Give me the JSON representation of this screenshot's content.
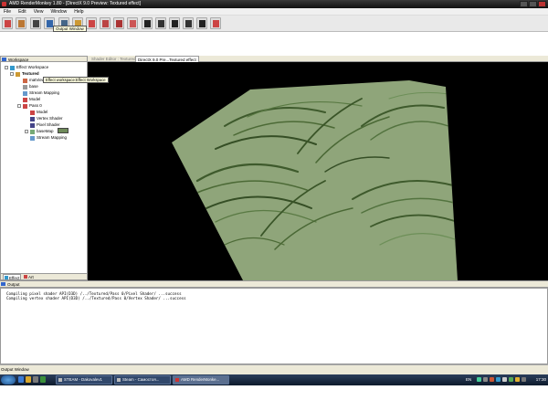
{
  "window": {
    "title": "AMD RenderMonkey 1.80 - [DirectX 9.0 Preview: Textured effect]"
  },
  "menu": [
    "File",
    "Edit",
    "View",
    "Window",
    "Help"
  ],
  "toolbar": {
    "tooltip": "Output Window",
    "buttons": [
      {
        "name": "toolbar-button-new",
        "color": "#c44"
      },
      {
        "name": "toolbar-button-open",
        "color": "#b73"
      },
      {
        "name": "toolbar-button-save",
        "color": "#444"
      },
      {
        "name": "toolbar-button-workspace",
        "color": "#36a"
      },
      {
        "name": "toolbar-button-preview",
        "color": "#468"
      },
      {
        "name": "toolbar-button-output",
        "color": "#c93"
      },
      {
        "name": "toolbar-button-add-1",
        "color": "#c44"
      },
      {
        "name": "toolbar-button-add-2",
        "color": "#b44"
      },
      {
        "name": "toolbar-button-add-3",
        "color": "#a33"
      },
      {
        "name": "toolbar-button-add-4",
        "color": "#c55"
      },
      {
        "name": "toolbar-button-camera-1",
        "color": "#222"
      },
      {
        "name": "toolbar-button-camera-2",
        "color": "#333"
      },
      {
        "name": "toolbar-button-camera-3",
        "color": "#222"
      },
      {
        "name": "toolbar-button-camera-4",
        "color": "#333"
      },
      {
        "name": "toolbar-button-camera-5",
        "color": "#222"
      },
      {
        "name": "toolbar-button-camera-6",
        "color": "#c44"
      }
    ]
  },
  "workspace": {
    "header": "Workspace",
    "tooltip": "Effect workspace:Effect Workspace",
    "nodes": [
      {
        "label": "Effect Workspace",
        "icon": "#39c",
        "bold": false
      },
      {
        "label": "Textured",
        "icon": "#c93",
        "bold": true
      },
      {
        "label": "matViewProj",
        "icon": "#c64",
        "bold": false
      },
      {
        "label": "base",
        "icon": "#999",
        "bold": false
      },
      {
        "label": "Stream Mapping",
        "icon": "#69c",
        "bold": false
      },
      {
        "label": "Model",
        "icon": "#c44",
        "bold": false
      },
      {
        "label": "Pass 0",
        "icon": "#c44",
        "bold": false
      },
      {
        "label": "Model",
        "icon": "#c44",
        "bold": false
      },
      {
        "label": "Vertex Shader",
        "icon": "#448",
        "bold": false
      },
      {
        "label": "Pixel Shader",
        "icon": "#448",
        "bold": false
      },
      {
        "label": "baseMap",
        "icon": "#7a7",
        "bold": false
      },
      {
        "label": "Stream Mapping",
        "icon": "#69c",
        "bold": false
      }
    ],
    "tabs": [
      "Effect",
      "Art"
    ]
  },
  "doc_tabs": [
    "Shader Editor : Textured",
    "DirectX 9.0 Pre...Textured effect"
  ],
  "output": {
    "header": "Output",
    "lines": [
      "Compiling pixel shader API(D3D) /../Textured/Pass 0/Pixel Shader/ ...success",
      "Compiling vertex shader API(D3D) /../Textured/Pass 0/Vertex Shader/ ...success"
    ]
  },
  "status_text": "Output Window",
  "taskbar": {
    "tasks": [
      "STEAM - Dakovalev1",
      "Steam - Самостоя...",
      "AMD RenderMonke..."
    ],
    "lang": "EN",
    "clock": "17:30"
  }
}
